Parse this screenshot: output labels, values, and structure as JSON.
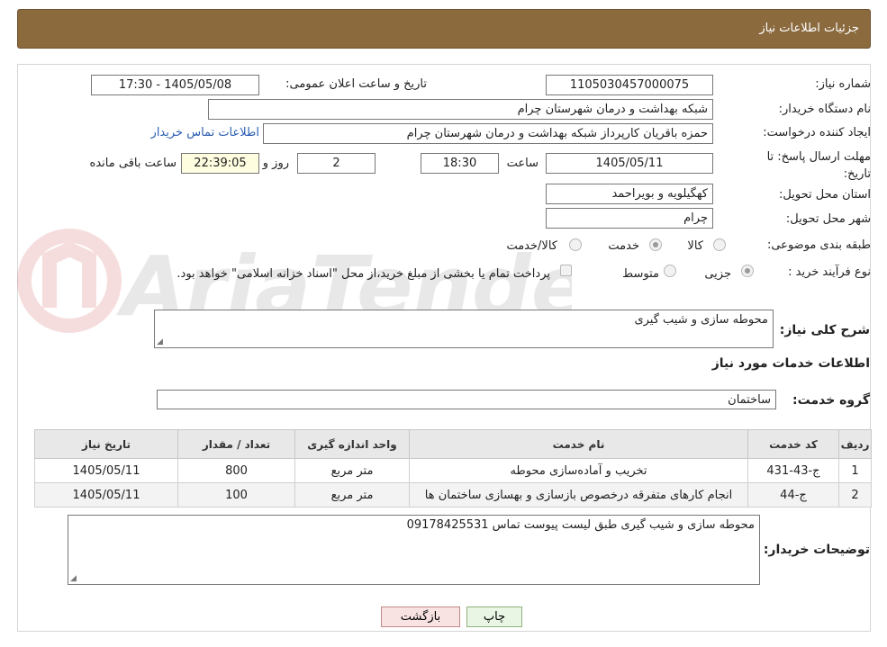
{
  "header": {
    "title": "جزئیات اطلاعات نیاز"
  },
  "form": {
    "need_number_label": "شماره نیاز:",
    "need_number": "1105030457000075",
    "announce_label": "تاریخ و ساعت اعلان عمومی:",
    "announce_value": "1405/05/08 - 17:30",
    "buyer_org_label": "نام دستگاه خریدار:",
    "buyer_org": "شبکه بهداشت و درمان شهرستان چرام",
    "creator_label": "ایجاد کننده درخواست:",
    "creator": "حمزه باقریان کارپرداز شبکه بهداشت و درمان شهرستان چرام",
    "contact_link": "اطلاعات تماس خریدار",
    "deadline_label": "مهلت ارسال پاسخ: تا تاریخ:",
    "deadline_date": "1405/05/11",
    "time_label": "ساعت",
    "deadline_time": "18:30",
    "days_value": "2",
    "days_label": "روز و",
    "remaining_time": "22:39:05",
    "remaining_label": "ساعت باقی مانده",
    "province_label": "استان محل تحویل:",
    "province": "کهگیلویه و بویراحمد",
    "city_label": "شهر محل تحویل:",
    "city": "چرام",
    "category_label": "طبقه بندی موضوعی:",
    "category_options": [
      "کالا",
      "خدمت",
      "کالا/خدمت"
    ],
    "category_selected": "خدمت",
    "process_label": "نوع فرآیند خرید :",
    "process_options": [
      "جزیی",
      "متوسط"
    ],
    "process_selected": "جزیی",
    "payment_note": "پرداخت تمام یا بخشی از مبلغ خرید،از محل \"اسناد خزانه اسلامی\" خواهد بود."
  },
  "summary": {
    "label": "شرح کلی نیاز:",
    "value": "محوطه سازی و شیب گیری"
  },
  "services_section": {
    "title": "اطلاعات خدمات مورد نیاز",
    "group_label": "گروه خدمت:",
    "group_value": "ساختمان"
  },
  "table": {
    "columns": [
      "ردیف",
      "کد خدمت",
      "نام خدمت",
      "واحد اندازه گیری",
      "تعداد / مقدار",
      "تاریخ نیاز"
    ],
    "rows": [
      [
        "1",
        "ج-43-431",
        "تخریب و آماده‌سازی محوطه",
        "متر مربع",
        "800",
        "1405/05/11"
      ],
      [
        "2",
        "ج-44",
        "انجام کارهای متفرقه درخصوص بازسازی و بهسازی ساختمان ها",
        "متر مربع",
        "100",
        "1405/05/11"
      ]
    ]
  },
  "buyer_notes": {
    "label": "توضیحات خریدار:",
    "value": "محوطه سازی و شیب گیری طبق لیست پیوست تماس 09178425531"
  },
  "buttons": {
    "print": "چاپ",
    "back": "بازگشت"
  },
  "watermark": {
    "text": "AriaTender.neT"
  },
  "colors": {
    "header_bg": "#8b6a3e",
    "link": "#2a5db0",
    "print_btn": "#eaf6e4",
    "back_btn": "#f8e2e2"
  }
}
